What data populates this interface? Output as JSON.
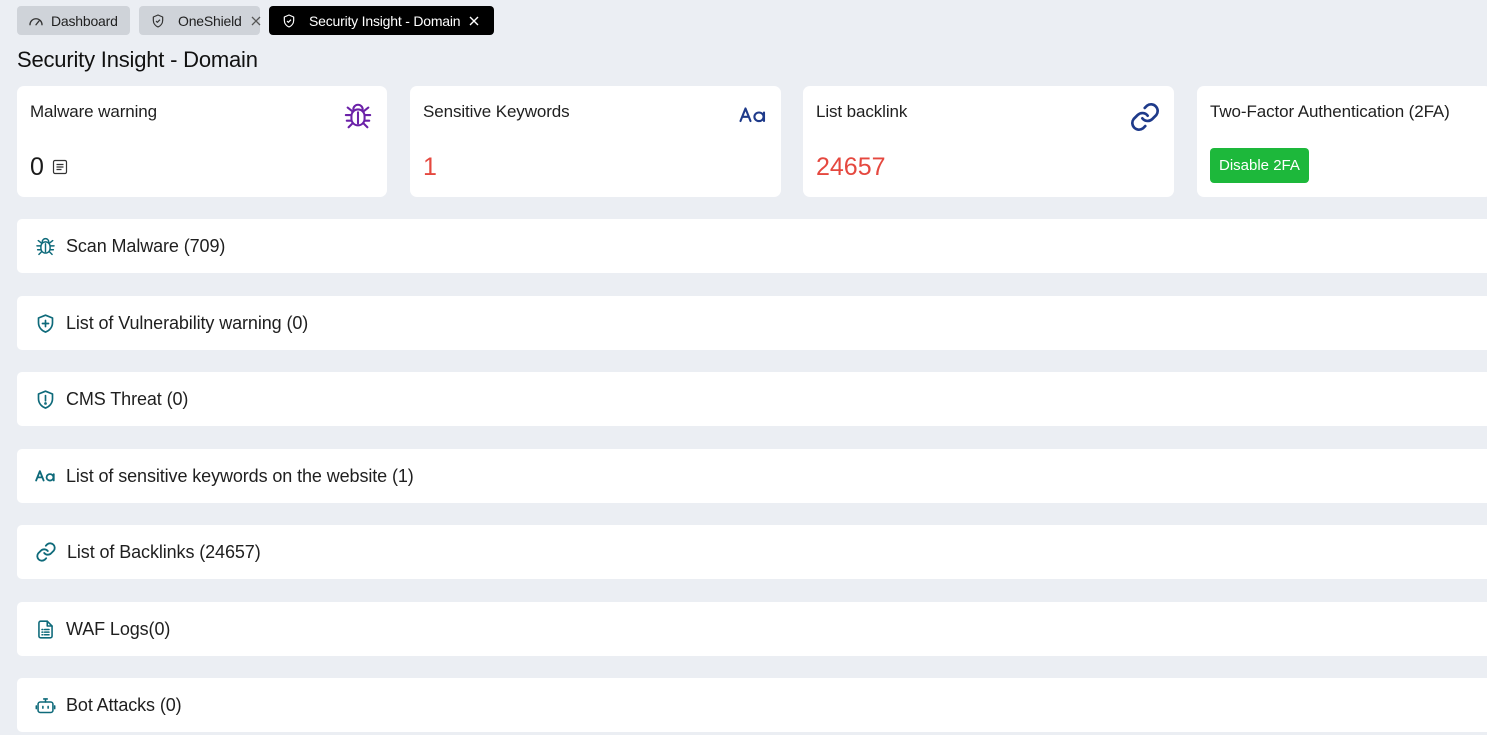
{
  "tabs": [
    {
      "label": "Dashboard",
      "icon": "gauge-icon",
      "active": false,
      "closable": false
    },
    {
      "label": "OneShield",
      "icon": "shield-icon",
      "active": false,
      "closable": true
    },
    {
      "label": "Security Insight - Domain",
      "icon": "shield-icon",
      "active": true,
      "closable": true
    }
  ],
  "page": {
    "title": "Security Insight - Domain"
  },
  "cards": {
    "malware": {
      "label": "Malware warning",
      "value": "0",
      "icon": "bug-icon",
      "detail_icon": "list-icon"
    },
    "keywords": {
      "label": "Sensitive Keywords",
      "value": "1",
      "icon": "text-aa-icon"
    },
    "backlink": {
      "label": "List backlink",
      "value": "24657",
      "icon": "link-icon"
    },
    "twofa": {
      "label": "Two-Factor Authentication (2FA)",
      "button_label": "Disable 2FA"
    }
  },
  "sections": [
    {
      "label": "Scan Malware (709)",
      "icon": "bug-icon"
    },
    {
      "label": "List of Vulnerability warning (0)",
      "icon": "shield-plus-icon"
    },
    {
      "label": "CMS Threat (0)",
      "icon": "shield-alert-icon"
    },
    {
      "label": "List of sensitive keywords on the website (1)",
      "icon": "text-aa-icon"
    },
    {
      "label": "List of Backlinks (24657)",
      "icon": "link-icon"
    },
    {
      "label": "WAF Logs(0)",
      "icon": "document-list-icon"
    },
    {
      "label": "Bot Attacks (0)",
      "icon": "robot-icon"
    }
  ],
  "colors": {
    "background": "#ebeef3",
    "tab_inactive": "#cfd3d9",
    "tab_active": "#000000",
    "value_red": "#e5483f",
    "button_green": "#1db83b",
    "bug_purple": "#6b21a8",
    "icon_navy": "#1e3a8a",
    "section_icon_teal": "#0e6a7a"
  }
}
